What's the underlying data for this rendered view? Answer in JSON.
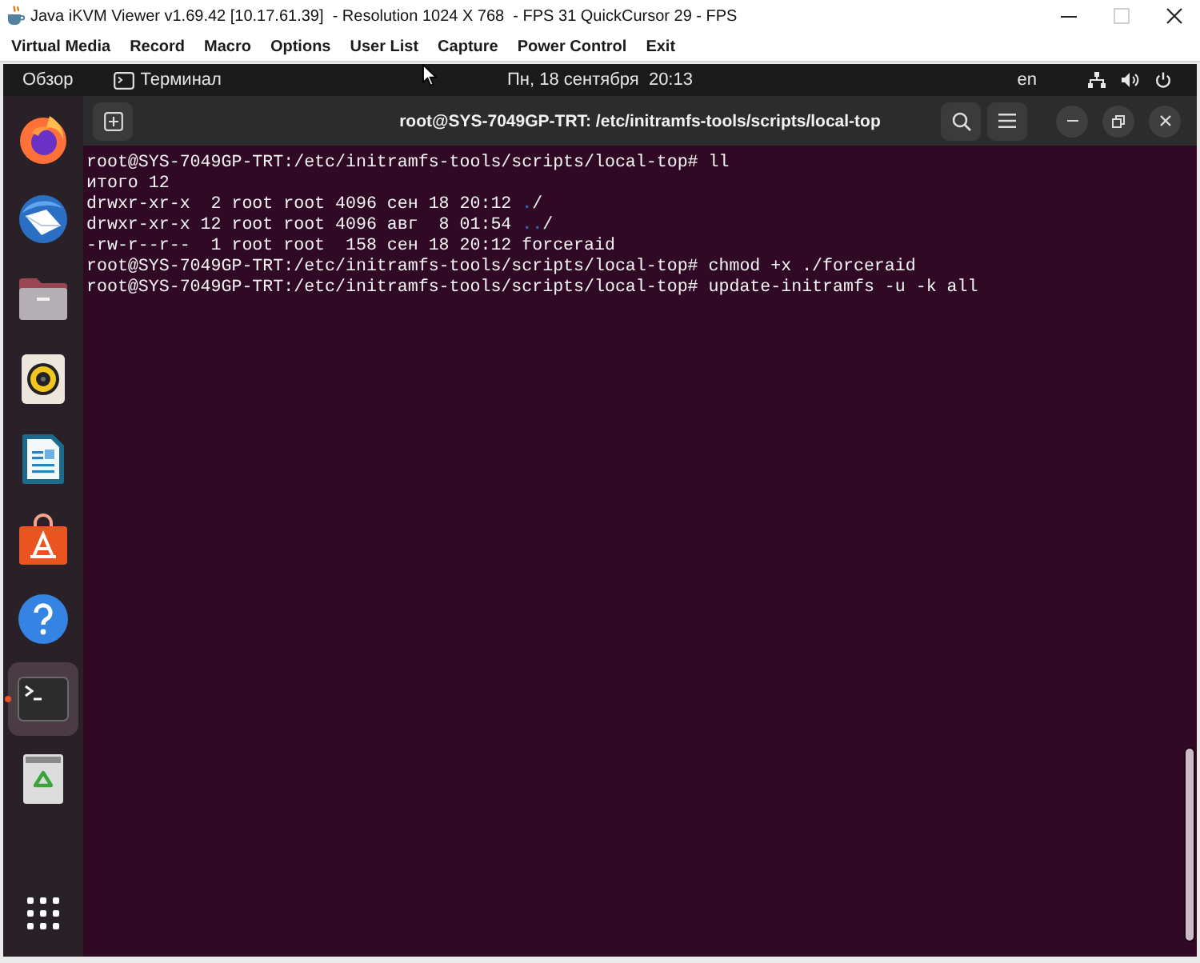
{
  "window": {
    "title": "Java iKVM Viewer v1.69.42 [10.17.61.39]  - Resolution 1024 X 768  - FPS 31 QuickCursor 29 - FPS",
    "maximize": {
      "disabled": true
    }
  },
  "menu": [
    "Virtual Media",
    "Record",
    "Macro",
    "Options",
    "User List",
    "Capture",
    "Power Control",
    "Exit"
  ],
  "top_bar": {
    "activities": "Обзор",
    "app_menu": "Терминал",
    "clock": "Пн, 18 сентября  20:13",
    "keyboard_layout": "en"
  },
  "dock": {
    "items": [
      {
        "kind": "browser",
        "selected": false,
        "running": false
      },
      {
        "kind": "mail",
        "selected": false,
        "running": false
      },
      {
        "kind": "files",
        "selected": false,
        "running": false
      },
      {
        "kind": "music",
        "selected": false,
        "running": false
      },
      {
        "kind": "document",
        "selected": false,
        "running": false
      },
      {
        "kind": "store",
        "selected": false,
        "running": false
      },
      {
        "kind": "help",
        "selected": false,
        "running": false
      },
      {
        "kind": "terminal",
        "selected": true,
        "running": true
      },
      {
        "kind": "trash",
        "selected": false,
        "running": false
      }
    ]
  },
  "terminal": {
    "title": "root@SYS-7049GP-TRT: /etc/initramfs-tools/scripts/local-top",
    "lines": [
      "root@SYS-7049GP-TRT:/etc/initramfs-tools/scripts/local-top# ll",
      "итого 12",
      "drwxr-xr-x  2 root root 4096 сен 18 20:12 **.**/",
      "drwxr-xr-x 12 root root 4096 авг  8 01:54 **..**/",
      "-rw-r--r--  1 root root  158 сен 18 20:12 forceraid",
      "root@SYS-7049GP-TRT:/etc/initramfs-tools/scripts/local-top# chmod +x ./forceraid",
      "root@SYS-7049GP-TRT:/etc/initramfs-tools/scripts/local-top# update-initramfs -u -k all"
    ]
  }
}
